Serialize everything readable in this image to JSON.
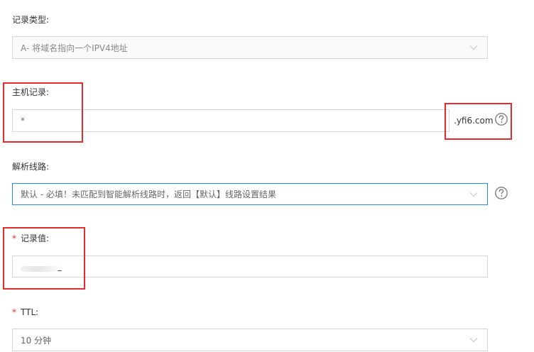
{
  "record_type": {
    "label": "记录类型:",
    "value": "A- 将域名指向一个IPV4地址"
  },
  "host_record": {
    "label": "主机记录:",
    "value": "*",
    "suffix": ".yfi6.com"
  },
  "resolution_line": {
    "label": "解析线路:",
    "value": "默认 - 必填！未匹配到智能解析线路时，返回【默认】线路设置结果"
  },
  "record_value": {
    "required_mark": "*",
    "label": "记录值:"
  },
  "ttl": {
    "required_mark": "*",
    "label": "TTL:",
    "value": "10 分钟"
  },
  "colors": {
    "highlight": "#e32d2d",
    "required": "#e0312e",
    "focus_border": "#2a8ad8",
    "field_border": "#d7d7d7"
  },
  "icons": {
    "select_chevron": "chevron-down-icon",
    "help": "question-circle-icon"
  }
}
